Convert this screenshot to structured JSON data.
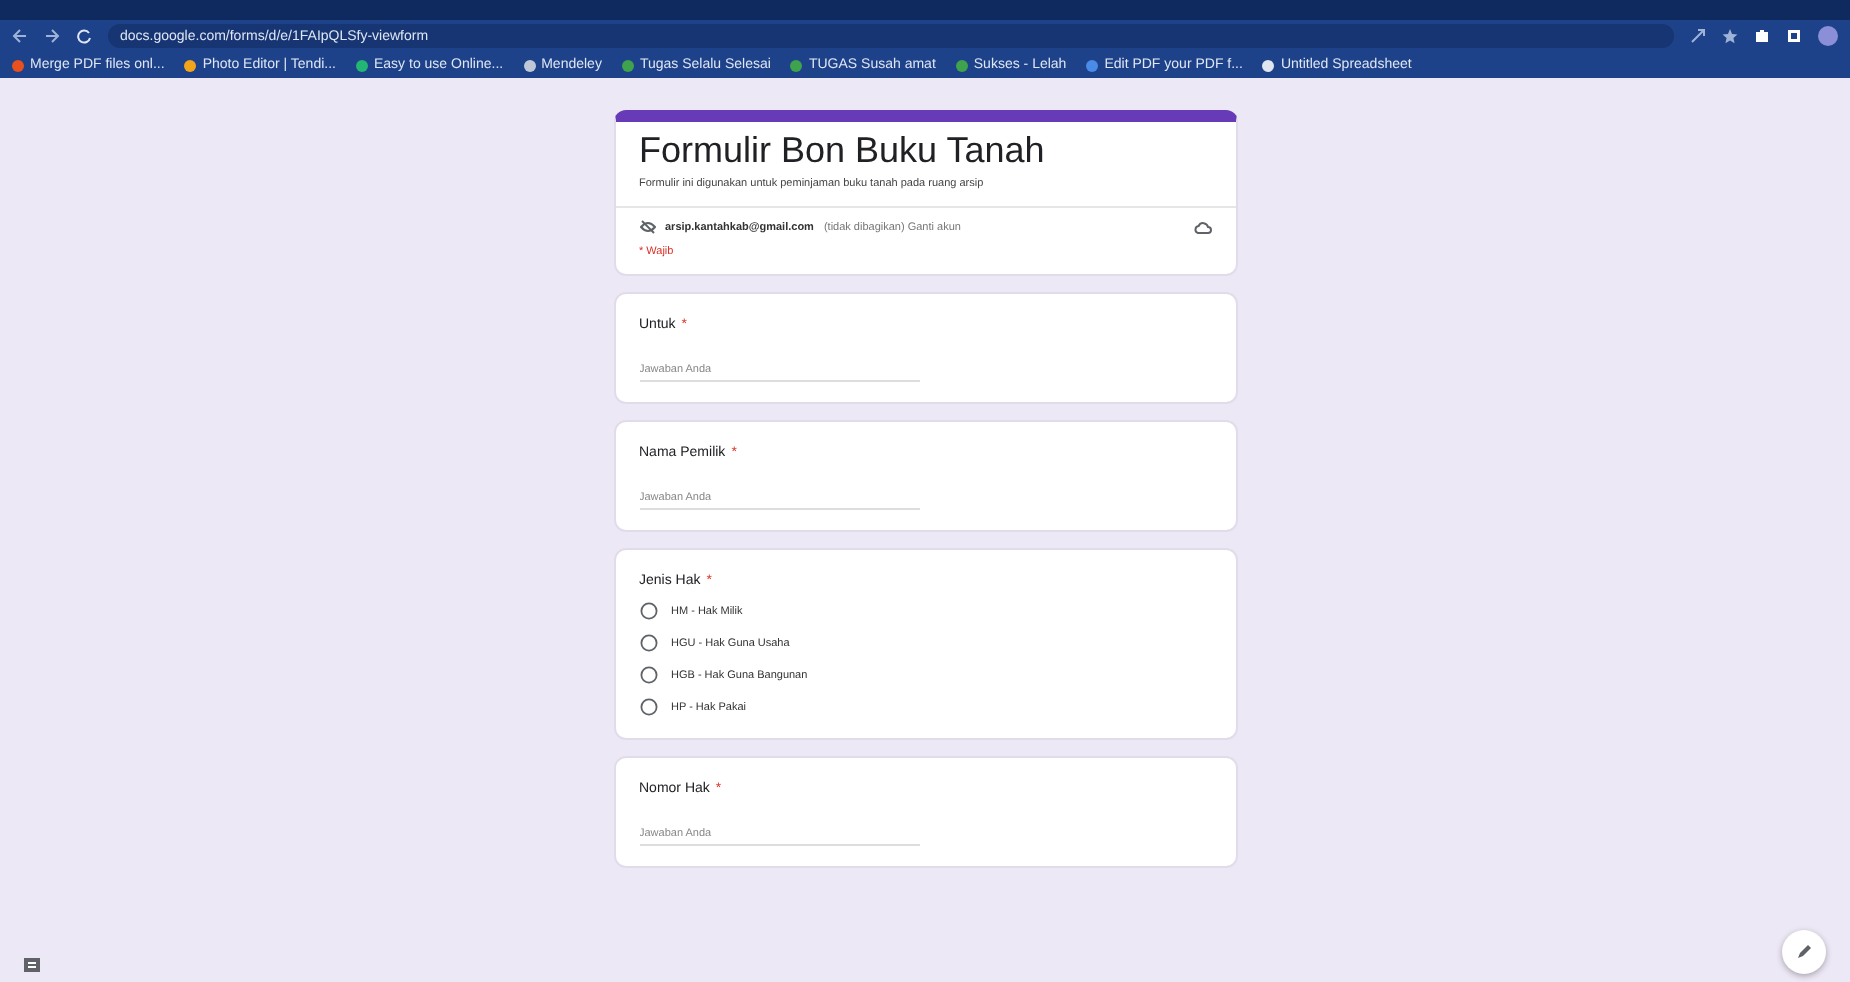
{
  "browser": {
    "url": "docs.google.com/forms/d/e/1FAIpQLSfy-viewform",
    "bookmarks": [
      {
        "label": "Merge PDF files onl...",
        "color": "#e8501e"
      },
      {
        "label": "Photo Editor | Tendi...",
        "color": "#f2a51a"
      },
      {
        "label": "Easy to use Online...",
        "color": "#22b573"
      },
      {
        "label": "Mendeley",
        "color": "#c0c8d8"
      },
      {
        "label": "Tugas Selalu Selesai",
        "color": "#3fa34d"
      },
      {
        "label": "TUGAS Susah amat",
        "color": "#3fa34d"
      },
      {
        "label": "Sukses - Lelah",
        "color": "#3fa34d"
      },
      {
        "label": "Edit PDF your PDF f...",
        "color": "#4a8be8"
      },
      {
        "label": "Untitled Spreadsheet",
        "color": "#e0e6f0"
      }
    ]
  },
  "form": {
    "title": "Formulir Bon Buku Tanah",
    "description": "Formulir ini digunakan untuk peminjaman buku tanah pada ruang arsip",
    "account": "arsip.kantahkab@gmail.com",
    "account_note": "(tidak dibagikan) Ganti akun",
    "required_note": "* Wajib",
    "questions": [
      {
        "kind": "text",
        "label": "Untuk",
        "required_mark": "*",
        "placeholder": "Jawaban Anda"
      },
      {
        "kind": "text",
        "label": "Nama Pemilik",
        "required_mark": "*",
        "placeholder": "Jawaban Anda"
      },
      {
        "kind": "radio",
        "label": "Jenis Hak",
        "required_mark": "*",
        "options": [
          {
            "label": "HM - Hak Milik",
            "selected": false
          },
          {
            "label": "HGU - Hak Guna Usaha",
            "selected": false
          },
          {
            "label": "HGB - Hak Guna Bangunan",
            "selected": false
          },
          {
            "label": "HP - Hak Pakai",
            "selected": false
          }
        ]
      },
      {
        "kind": "text",
        "label": "Nomor Hak",
        "required_mark": "*",
        "placeholder": "Jawaban Anda"
      }
    ]
  }
}
